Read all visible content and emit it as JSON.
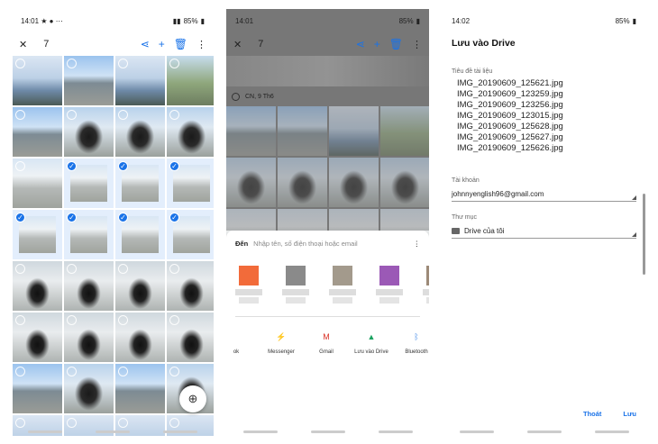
{
  "status": {
    "p1": {
      "time": "14:01",
      "left_icons": "★ ● ⋯",
      "right": "85%"
    },
    "p2": {
      "time": "14:01",
      "right": "85%"
    },
    "p3": {
      "time": "14:02",
      "right": "85%"
    }
  },
  "gallery": {
    "selected_count": "7",
    "tiles": [
      {
        "cls": "sky",
        "sel": false
      },
      {
        "cls": "city",
        "sel": false
      },
      {
        "cls": "sky",
        "sel": false
      },
      {
        "cls": "trees",
        "sel": false
      },
      {
        "cls": "city",
        "sel": false
      },
      {
        "cls": "bike2",
        "sel": false
      },
      {
        "cls": "bike2",
        "sel": false
      },
      {
        "cls": "bike2",
        "sel": false
      },
      {
        "cls": "road",
        "sel": false
      },
      {
        "cls": "road",
        "sel": true
      },
      {
        "cls": "road",
        "sel": true
      },
      {
        "cls": "road",
        "sel": true
      },
      {
        "cls": "road",
        "sel": true
      },
      {
        "cls": "road",
        "sel": true
      },
      {
        "cls": "road",
        "sel": true
      },
      {
        "cls": "road",
        "sel": true
      },
      {
        "cls": "bike",
        "sel": false
      },
      {
        "cls": "bike",
        "sel": false
      },
      {
        "cls": "bike",
        "sel": false
      },
      {
        "cls": "bike",
        "sel": false
      },
      {
        "cls": "bike",
        "sel": false
      },
      {
        "cls": "bike",
        "sel": false
      },
      {
        "cls": "bike",
        "sel": false
      },
      {
        "cls": "bike",
        "sel": false
      },
      {
        "cls": "city",
        "sel": false
      },
      {
        "cls": "bike2",
        "sel": false
      },
      {
        "cls": "city",
        "sel": false
      },
      {
        "cls": "bike2",
        "sel": false
      },
      {
        "cls": "sky",
        "sel": false
      },
      {
        "cls": "sky",
        "sel": false
      },
      {
        "cls": "sky",
        "sel": false
      },
      {
        "cls": "sky",
        "sel": false
      }
    ]
  },
  "share": {
    "date_label": "CN, 9 Th6",
    "to_label": "Đến",
    "to_placeholder": "Nhập tên, số điện thoại hoặc email",
    "contacts": [
      "#f26b3a",
      "#8a8a8a",
      "#a39a8c",
      "#9b59b6",
      "#9c8a78"
    ],
    "apps": [
      {
        "label": "ok",
        "icon": "",
        "color": "#3b5998"
      },
      {
        "label": "Messenger",
        "icon": "⚡",
        "color": "#0084ff"
      },
      {
        "label": "Gmail",
        "icon": "M",
        "color": "#d93025"
      },
      {
        "label": "Lưu vào Drive",
        "icon": "▲",
        "color": "#1aa260"
      },
      {
        "label": "Bluetooth",
        "icon": "ᛒ",
        "color": "#4a8fe8"
      }
    ]
  },
  "drive": {
    "title": "Lưu vào Drive",
    "doc_title_label": "Tiêu đề tài liệu",
    "files": [
      "IMG_20190609_125621.jpg",
      "IMG_20190609_123259.jpg",
      "IMG_20190609_123256.jpg",
      "IMG_20190609_123015.jpg",
      "IMG_20190609_125628.jpg",
      "IMG_20190609_125627.jpg",
      "IMG_20190609_125626.jpg"
    ],
    "account_label": "Tài khoản",
    "account": "johnnyenglish96@gmail.com",
    "folder_label": "Thư mục",
    "folder": "Drive của tôi",
    "cancel": "Thoát",
    "save": "Lưu"
  }
}
